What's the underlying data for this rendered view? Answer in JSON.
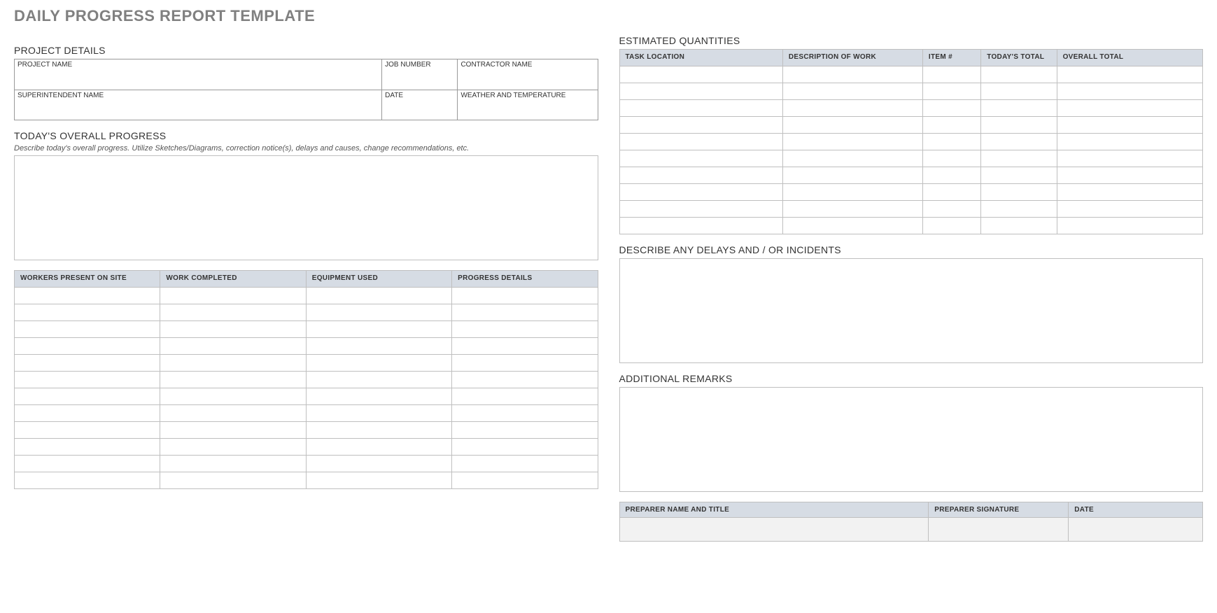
{
  "title": "DAILY PROGRESS REPORT TEMPLATE",
  "left": {
    "project_details": {
      "heading": "PROJECT DETAILS",
      "project_name_label": "PROJECT NAME",
      "job_number_label": "JOB NUMBER",
      "contractor_name_label": "CONTRACTOR NAME",
      "superintendent_label": "SUPERINTENDENT NAME",
      "date_label": "DATE",
      "weather_label": "WEATHER AND TEMPERATURE",
      "project_name": "",
      "job_number": "",
      "contractor_name": "",
      "superintendent": "",
      "date": "",
      "weather": ""
    },
    "overall_progress": {
      "heading": "TODAY'S OVERALL PROGRESS",
      "desc": "Describe today's overall progress.  Utilize Sketches/Diagrams, correction notice(s), delays and causes, change recommendations, etc.",
      "text": ""
    },
    "progress_table": {
      "headers": [
        "WORKERS PRESENT ON SITE",
        "WORK COMPLETED",
        "EQUIPMENT USED",
        "PROGRESS DETAILS"
      ],
      "rows": [
        [
          "",
          "",
          "",
          ""
        ],
        [
          "",
          "",
          "",
          ""
        ],
        [
          "",
          "",
          "",
          ""
        ],
        [
          "",
          "",
          "",
          ""
        ],
        [
          "",
          "",
          "",
          ""
        ],
        [
          "",
          "",
          "",
          ""
        ],
        [
          "",
          "",
          "",
          ""
        ],
        [
          "",
          "",
          "",
          ""
        ],
        [
          "",
          "",
          "",
          ""
        ],
        [
          "",
          "",
          "",
          ""
        ],
        [
          "",
          "",
          "",
          ""
        ],
        [
          "",
          "",
          "",
          ""
        ]
      ]
    }
  },
  "right": {
    "quantities": {
      "heading": "ESTIMATED QUANTITIES",
      "headers": [
        "TASK LOCATION",
        "DESCRIPTION OF WORK",
        "ITEM #",
        "TODAY'S TOTAL",
        "OVERALL TOTAL"
      ],
      "rows": [
        [
          "",
          "",
          "",
          "",
          ""
        ],
        [
          "",
          "",
          "",
          "",
          ""
        ],
        [
          "",
          "",
          "",
          "",
          ""
        ],
        [
          "",
          "",
          "",
          "",
          ""
        ],
        [
          "",
          "",
          "",
          "",
          ""
        ],
        [
          "",
          "",
          "",
          "",
          ""
        ],
        [
          "",
          "",
          "",
          "",
          ""
        ],
        [
          "",
          "",
          "",
          "",
          ""
        ],
        [
          "",
          "",
          "",
          "",
          ""
        ],
        [
          "",
          "",
          "",
          "",
          ""
        ]
      ]
    },
    "delays": {
      "heading": "DESCRIBE ANY DELAYS AND / OR INCIDENTS",
      "text": ""
    },
    "remarks": {
      "heading": "ADDITIONAL REMARKS",
      "text": ""
    },
    "signoff": {
      "headers": [
        "PREPARER NAME AND TITLE",
        "PREPARER SIGNATURE",
        "DATE"
      ],
      "name": "",
      "signature": "",
      "date": ""
    }
  }
}
